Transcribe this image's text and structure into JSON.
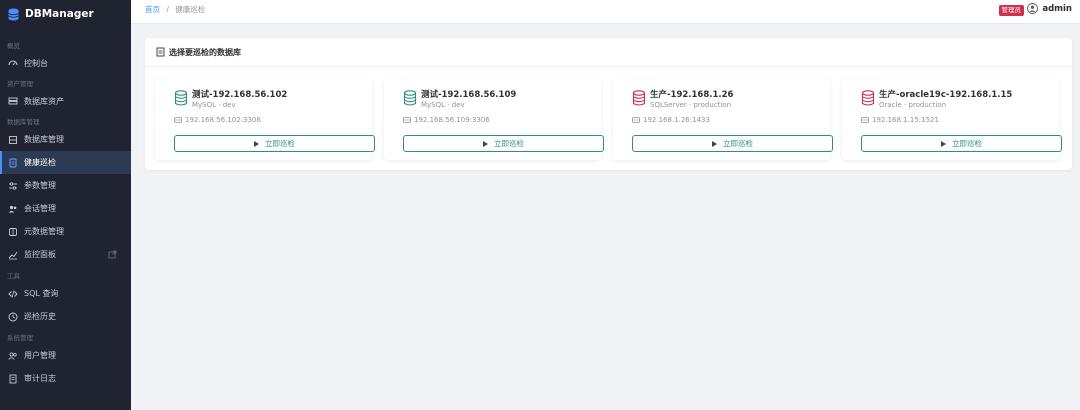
{
  "app": {
    "name": "DBManager"
  },
  "sidebar": {
    "groups": [
      {
        "label": "概览",
        "items": [
          {
            "label": "控制台",
            "icon": "dashboard-icon"
          }
        ]
      },
      {
        "label": "资产管理",
        "items": [
          {
            "label": "数据库资产",
            "icon": "server-icon"
          }
        ]
      },
      {
        "label": "数据库管理",
        "items": [
          {
            "label": "数据库管理",
            "icon": "database-icon"
          },
          {
            "label": "健康巡检",
            "icon": "clipboard-icon",
            "active": true
          },
          {
            "label": "参数管理",
            "icon": "sliders-icon"
          },
          {
            "label": "会话管理",
            "icon": "users-icon"
          },
          {
            "label": "元数据管理",
            "icon": "cube-icon"
          },
          {
            "label": "监控面板",
            "icon": "chart-icon",
            "external": true
          }
        ]
      },
      {
        "label": "工具",
        "items": [
          {
            "label": "SQL 查询",
            "icon": "code-icon"
          },
          {
            "label": "巡检历史",
            "icon": "clock-icon"
          }
        ]
      },
      {
        "label": "系统管理",
        "items": [
          {
            "label": "用户管理",
            "icon": "users-icon"
          },
          {
            "label": "审计日志",
            "icon": "log-icon"
          }
        ]
      }
    ]
  },
  "header": {
    "breadcrumb": {
      "home": "首页",
      "separator": "/",
      "current": "健康巡检"
    },
    "role_badge": "管理员",
    "user": "admin"
  },
  "panel": {
    "title": "选择要巡检的数据库",
    "databases": [
      {
        "name": "测试-192.168.56.102",
        "type": "MySQL · dev",
        "host": "192.168.56.102:3306",
        "icon_color": "#2f8f7f",
        "button": "立即巡检"
      },
      {
        "name": "测试-192.168.56.109",
        "type": "MySQL · dev",
        "host": "192.168.56.109:3306",
        "icon_color": "#2f8f7f",
        "button": "立即巡检"
      },
      {
        "name": "生产-192.168.1.26",
        "type": "SQLServer · production",
        "host": "192.168.1.26:1433",
        "icon_color": "#d03050",
        "button": "立即巡检"
      },
      {
        "name": "生产-oracle19c-192.168.1.15",
        "type": "Oracle · production",
        "host": "192.168.1.15:1521",
        "icon_color": "#d03050",
        "button": "立即巡检"
      }
    ]
  },
  "colors": {
    "sidebar_bg": "#1f2430",
    "accent": "#2f8f7f",
    "danger": "#d03050",
    "link": "#409eff"
  }
}
